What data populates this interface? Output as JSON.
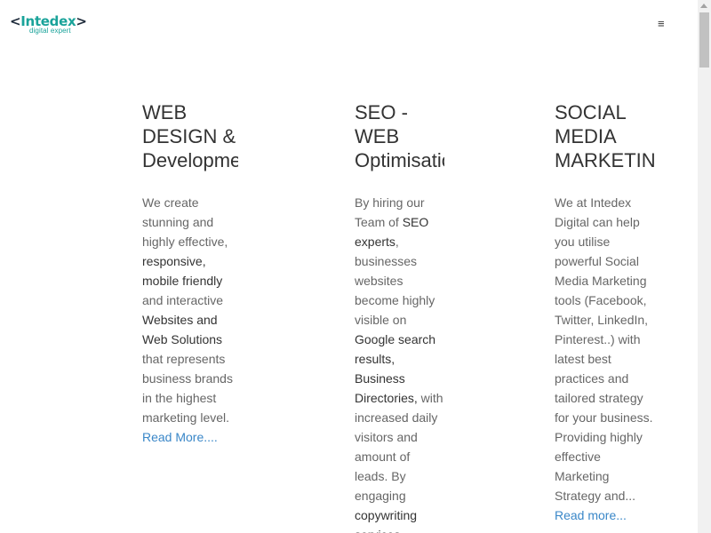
{
  "header": {
    "logo_text_open": "<",
    "logo_text": "Intedex",
    "logo_text_close": ">",
    "logo_subtitle": "digital expert",
    "menu_icon": "hamburger-icon",
    "menu_glyph": "≡"
  },
  "columns": [
    {
      "title_lines": [
        "WEB",
        "DESIGN &",
        "Development"
      ],
      "text": [
        {
          "t": "We create stunning and highly effective, "
        },
        {
          "b": "responsive, mobile friendly"
        },
        {
          "t": " and interactive "
        },
        {
          "b": "Websites and Web Solutions"
        },
        {
          "t": " that represents business brands in the highest marketing level. "
        }
      ],
      "link": "Read More...."
    },
    {
      "title_lines": [
        "SEO -",
        "WEB",
        "Optimisation"
      ],
      "text": [
        {
          "t": "By hiring our Team of "
        },
        {
          "b": "SEO experts"
        },
        {
          "t": ", businesses websites become highly visible on "
        },
        {
          "b": "Google search results, Business Directories,"
        },
        {
          "t": " with increased daily visitors and amount of leads. By engaging "
        },
        {
          "b": "copywriting services"
        }
      ],
      "link": ""
    },
    {
      "title_lines": [
        "SOCIAL",
        "MEDIA",
        "MARKETING"
      ],
      "text": [
        {
          "t": "We at Intedex Digital can help you utilise powerful Social Media Marketing tools (Facebook, Twitter, LinkedIn, Pinterest..) with latest best practices and tailored strategy for your business. Providing highly effective Marketing Strategy and... "
        }
      ],
      "link": "Read more..."
    }
  ]
}
